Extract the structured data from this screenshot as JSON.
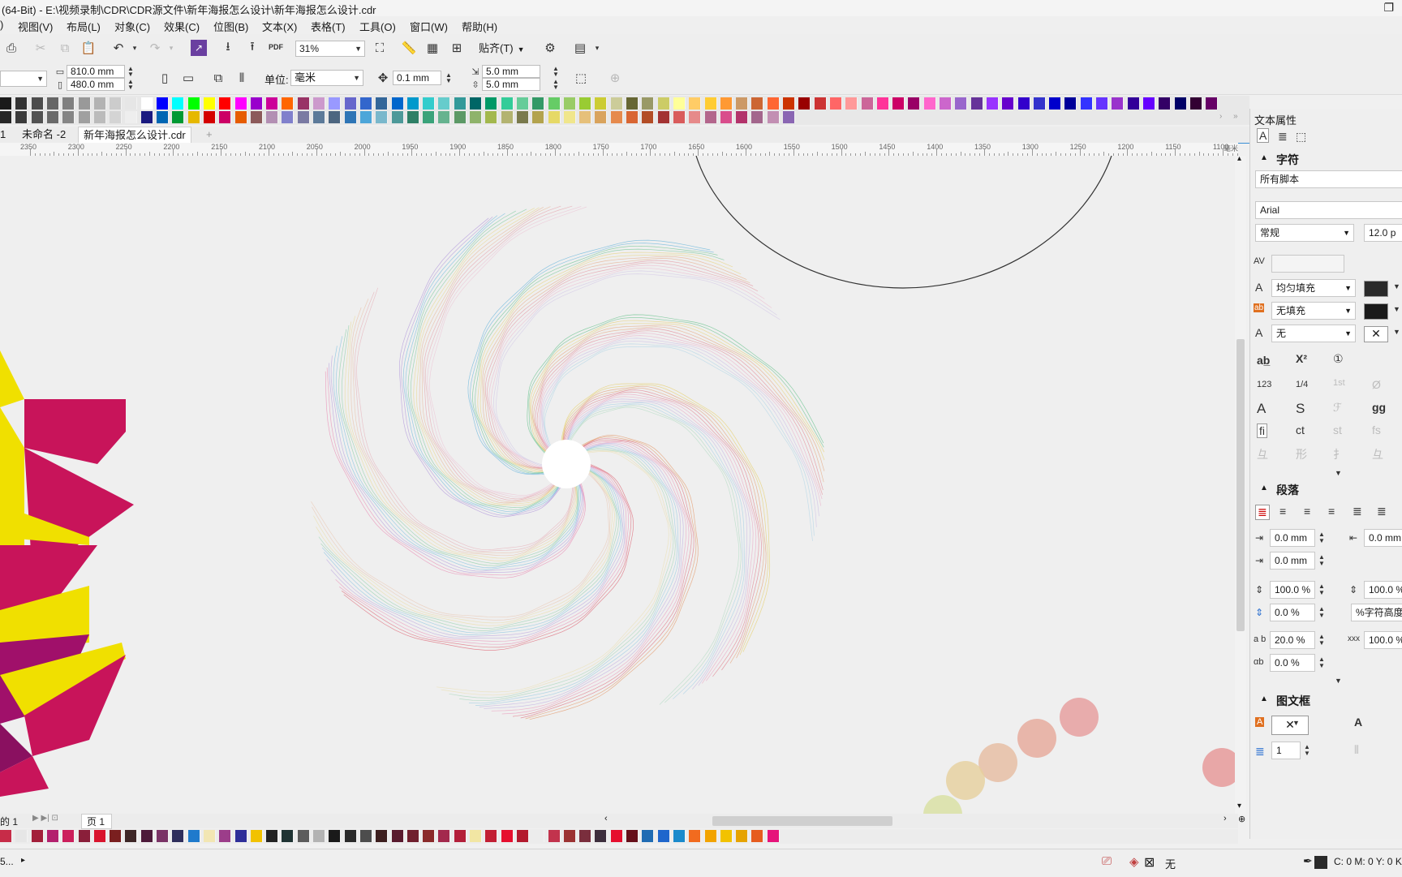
{
  "window": {
    "title": "(64-Bit) - E:\\视频录制\\CDR\\CDR源文件\\新年海报怎么设计\\新年海报怎么设计.cdr",
    "close_glyph": "⬜"
  },
  "menu": [
    {
      "label": ")"
    },
    {
      "label": "视图(V)"
    },
    {
      "label": "布局(L)"
    },
    {
      "label": "对象(C)"
    },
    {
      "label": "效果(C)"
    },
    {
      "label": "位图(B)"
    },
    {
      "label": "文本(X)"
    },
    {
      "label": "表格(T)"
    },
    {
      "label": "工具(O)"
    },
    {
      "label": "窗口(W)"
    },
    {
      "label": "帮助(H)"
    }
  ],
  "toolbar": {
    "zoom": "31%",
    "snap_label": "贴齐(T)",
    "pdf_label": "PDF"
  },
  "propbar": {
    "width": "810.0 mm",
    "height": "480.0 mm",
    "unit_label": "单位:",
    "unit_value": "毫米",
    "nudge": "0.1 mm",
    "dup_x": "5.0 mm",
    "dup_y": "5.0 mm"
  },
  "colors": {
    "palette_row1": [
      "#1a1a1a",
      "#333333",
      "#4d4d4d",
      "#666666",
      "#808080",
      "#999999",
      "#b3b3b3",
      "#cccccc",
      "#e6e6e6",
      "#ffffff",
      "#0000ff",
      "#00ffff",
      "#00ff00",
      "#ffff00",
      "#ff0000",
      "#ff00ff",
      "#9900cc",
      "#cc0099",
      "#ff6600",
      "#993366",
      "#cc99cc",
      "#9999ff",
      "#6666cc",
      "#3366cc",
      "#336699",
      "#0066cc",
      "#0099cc",
      "#33cccc",
      "#66cccc",
      "#339999",
      "#006666",
      "#009966",
      "#33cc99",
      "#66cc99",
      "#339966",
      "#66cc66",
      "#99cc66",
      "#99cc33",
      "#cccc33",
      "#cccc99",
      "#666633",
      "#999966",
      "#cccc66",
      "#ffff99",
      "#ffcc66",
      "#ffcc33",
      "#ff9933",
      "#cc9966",
      "#cc6633",
      "#ff6633",
      "#cc3300",
      "#990000",
      "#cc3333",
      "#ff6666",
      "#ff9999",
      "#cc6699",
      "#ff3399",
      "#cc0066",
      "#990066",
      "#ff66cc",
      "#cc66cc",
      "#9966cc",
      "#663399",
      "#9933ff",
      "#6600cc",
      "#3300cc",
      "#3333cc",
      "#0000cc",
      "#000099",
      "#3333ff",
      "#6633ff",
      "#9933cc",
      "#330099",
      "#6600ff",
      "#330066",
      "#000066",
      "#330033",
      "#660066"
    ],
    "palette_row2": [
      "#262626",
      "#3a3a3a",
      "#525252",
      "#6a6a6a",
      "#858585",
      "#a0a0a0",
      "#bbbbbb",
      "#d4d4d4",
      "#eeeeee",
      "#1a1a80",
      "#0066b3",
      "#009933",
      "#e6b800",
      "#d40000",
      "#cc0066",
      "#e65c00",
      "#8c5a5a",
      "#b38fb3",
      "#8080cc",
      "#7a7aa3",
      "#5c7a99",
      "#4d6680",
      "#2e75b6",
      "#4da6d9",
      "#7ab8cc",
      "#4d9999",
      "#2e8066",
      "#3aa37a",
      "#66b38f",
      "#5c9966",
      "#8fb36b",
      "#a3b84d",
      "#b3b370",
      "#7a7a4d",
      "#b3a34d",
      "#e6d966",
      "#f0e68c",
      "#e6c07a",
      "#d9a35c",
      "#e68a4d",
      "#d96633",
      "#b34d26",
      "#a33333",
      "#d95c5c",
      "#e68a8a",
      "#b3668c",
      "#d94d8c",
      "#b3336b",
      "#a3668c",
      "#c28fb3",
      "#8a66b3"
    ],
    "bottom_palette": [
      "#c72c48",
      "#e6e6e6",
      "#a31f3a",
      "#b3206e",
      "#cc1f5c",
      "#8a1f3a",
      "#d9142d",
      "#7a1f1f",
      "#3d2626",
      "#4d1a3a",
      "#7a3366",
      "#2e2e5c",
      "#1f7acc",
      "#f2e6b3",
      "#9c3d8a",
      "#2e2e99",
      "#f2c200",
      "#222222",
      "#1f3333",
      "#5c5c5c",
      "#b3b3b3",
      "#1a1a1a",
      "#2a2a2a",
      "#4d4d4d",
      "#3d1f1f",
      "#591a2e",
      "#701f2e",
      "#8a2a2a",
      "#a3294d",
      "#b31f3a",
      "#f2e6a3",
      "#c21f33",
      "#e60f2e",
      "#b31a2e",
      "#ececec",
      "#c2334d",
      "#9c3333",
      "#7a2e3d",
      "#3d2e3d",
      "#e60f2e",
      "#660f1a",
      "#1f6bb3",
      "#1f66cc",
      "#1a8acc",
      "#f26b1f",
      "#f2a300",
      "#f2c200",
      "#e6a300",
      "#e65c1f",
      "#e6137a"
    ]
  },
  "tabs": [
    {
      "label": "1"
    },
    {
      "label": "未命名 -2"
    },
    {
      "label": "新年海报怎么设计.cdr"
    },
    {
      "label": "+"
    }
  ],
  "ruler": [
    "2350",
    "2300",
    "2250",
    "2200",
    "2150",
    "2100",
    "2050",
    "2000",
    "1950",
    "1900",
    "1850",
    "1800",
    "1750",
    "1700",
    "1650",
    "1600",
    "1550",
    "1500",
    "1450",
    "1400",
    "1350",
    "1300",
    "1250",
    "1200",
    "1150",
    "1100"
  ],
  "ruler_unit": "毫米",
  "pagebar": {
    "page_count": "的 1",
    "page_tab": "页 1"
  },
  "dock": {
    "header": "文本属性",
    "char_section": "字符",
    "script": "所有脚本",
    "font": "Arial",
    "style": "常规",
    "size": "12.0 p",
    "fill_type": "均匀填充",
    "bg_fill": "无填充",
    "outline": "无",
    "para_section": "段落",
    "left_indent": "0.0 mm",
    "right_indent": "0.0 mm",
    "first_indent": "0.0 mm",
    "line_spacing": "100.0 %",
    "line_spacing2": "100.0 %",
    "before_para": "0.0 %",
    "spacing_unit": "%字符高度",
    "char_spacing": "20.0 %",
    "word_spacing": "100.0 %",
    "lang_spacing": "0.0 %",
    "frame_section": "图文框",
    "columns": "1"
  },
  "status": {
    "left": "5...",
    "fill_none": "无",
    "cmyk": "C: 0 M: 0 Y: 0 K:"
  }
}
